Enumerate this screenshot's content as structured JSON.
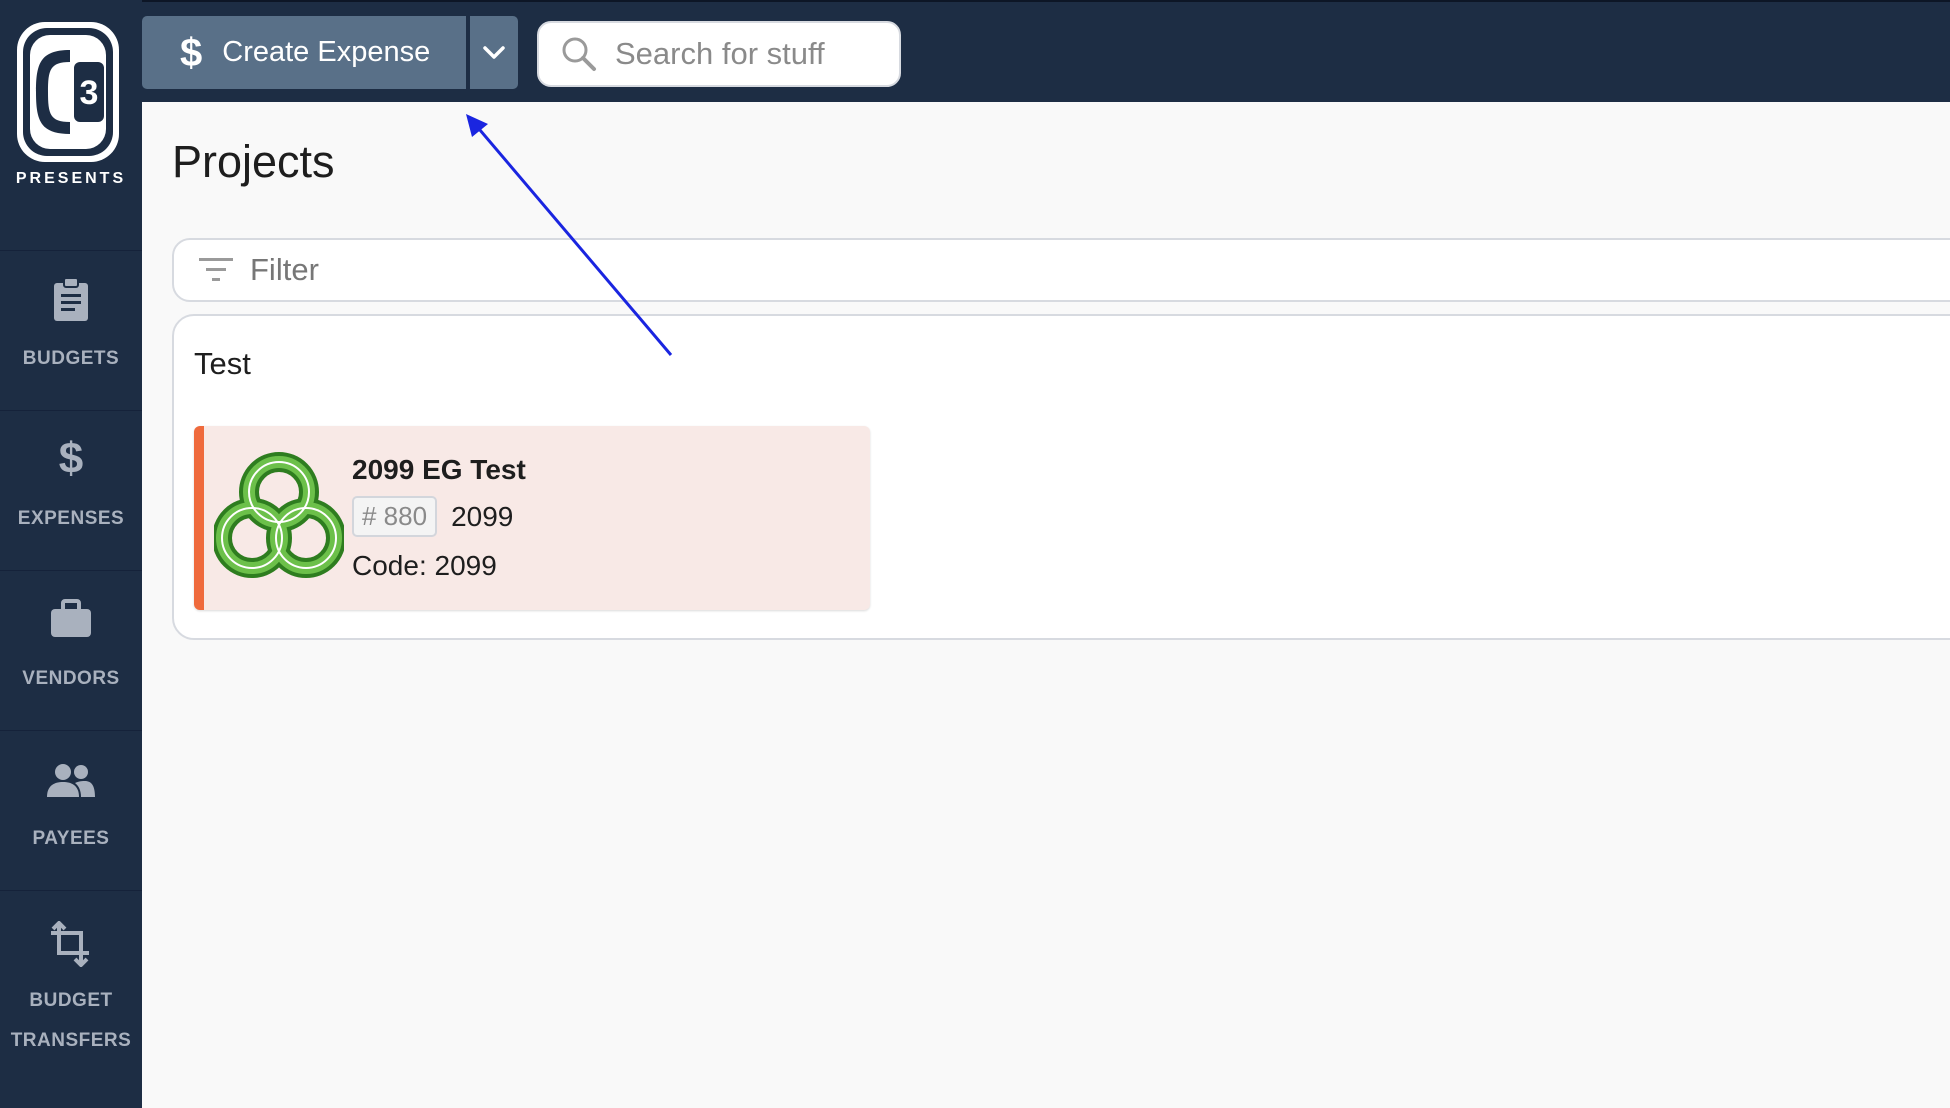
{
  "brand": {
    "logo_text": "PRESENTS"
  },
  "sidebar": {
    "items": [
      {
        "label": "BUDGETS",
        "icon": "clipboard-icon"
      },
      {
        "label": "EXPENSES",
        "icon": "dollar-icon"
      },
      {
        "label": "VENDORS",
        "icon": "briefcase-icon"
      },
      {
        "label": "PAYEES",
        "icon": "people-icon"
      },
      {
        "label": "BUDGET TRANSFERS",
        "icon": "crop-transfer-icon"
      }
    ]
  },
  "header": {
    "create_button_label": "Create Expense",
    "create_button_icon": "$",
    "search_placeholder": "Search for stuff"
  },
  "main": {
    "title": "Projects",
    "filter_placeholder": "Filter",
    "groups": [
      {
        "name": "Test",
        "projects": [
          {
            "name": "2099 EG Test",
            "badge": "# 880",
            "year": "2099",
            "code": "Code: 2099",
            "accent_color": "#ef6a3c"
          }
        ]
      }
    ]
  },
  "colors": {
    "sidebar_bg": "#1d2d44",
    "button_bg": "#597088",
    "card_bg": "#f8e9e6",
    "annotation_arrow": "#1a25e0"
  }
}
